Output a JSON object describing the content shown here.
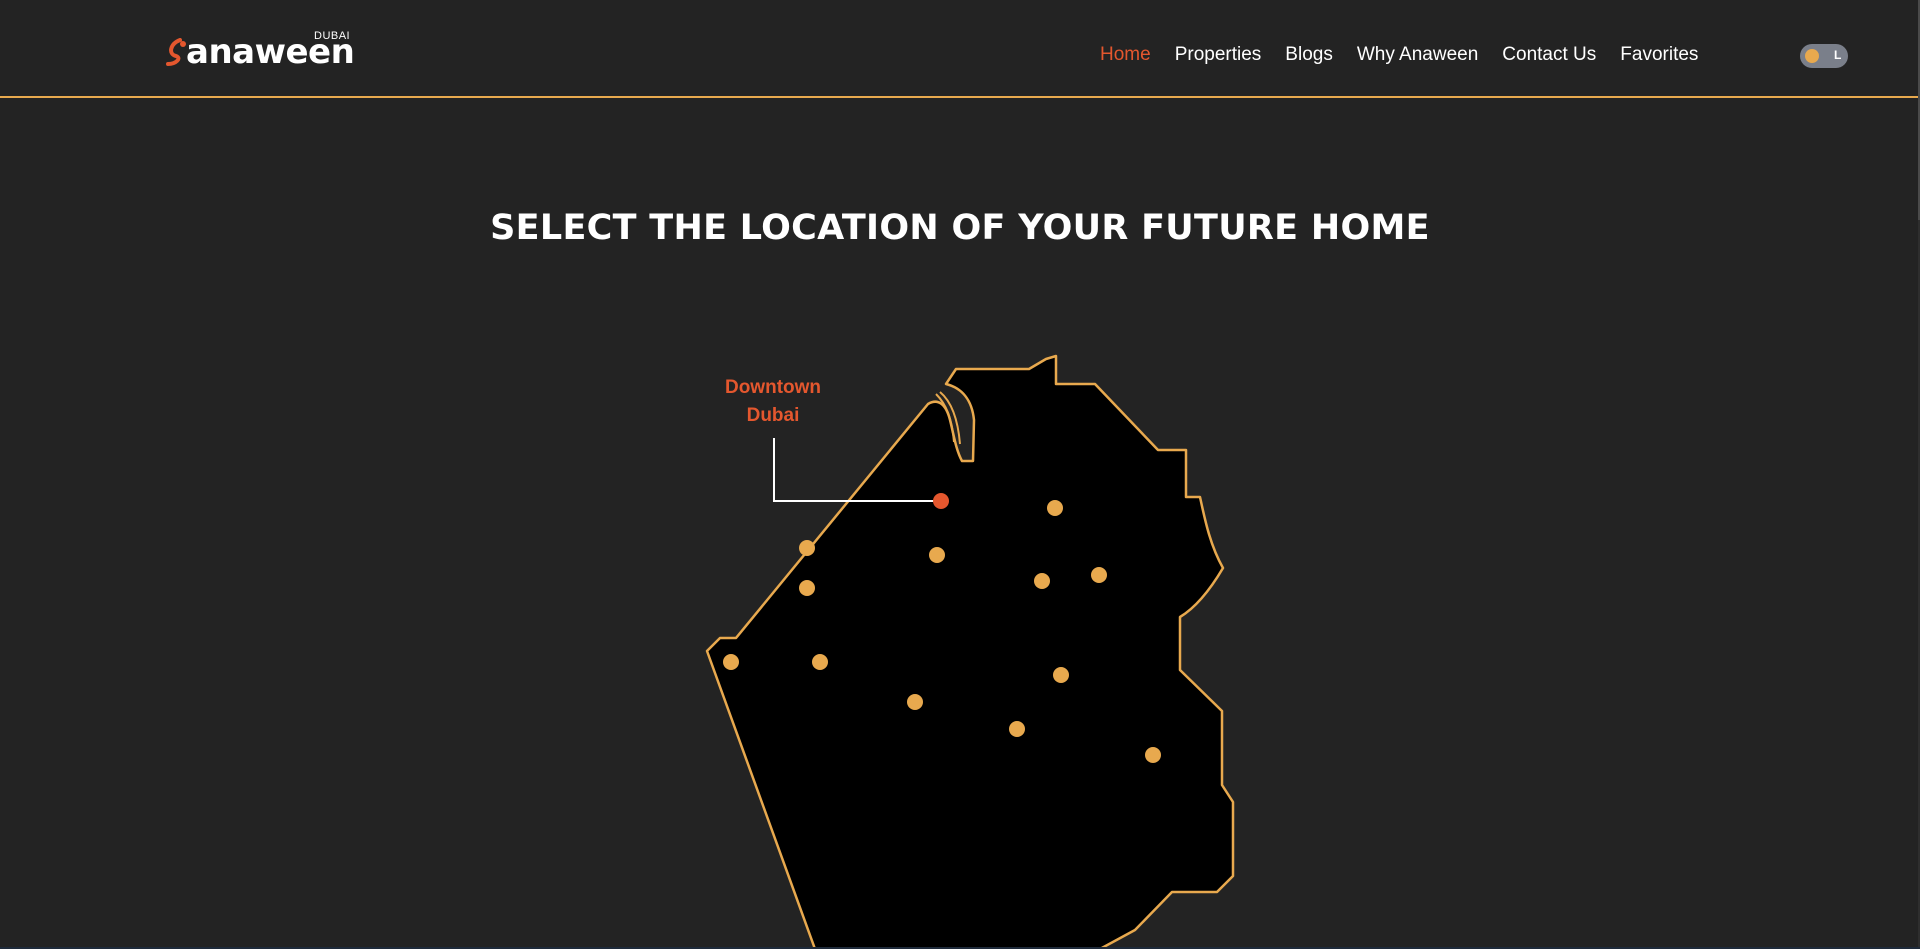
{
  "header": {
    "logo": {
      "name": "anaween",
      "sub": "DUBAI"
    },
    "nav": [
      {
        "label": "Home",
        "active": true
      },
      {
        "label": "Properties",
        "active": false
      },
      {
        "label": "Blogs",
        "active": false
      },
      {
        "label": "Why Anaween",
        "active": false
      },
      {
        "label": "Contact Us",
        "active": false
      },
      {
        "label": "Favorites",
        "active": false
      }
    ],
    "theme_toggle": {
      "label": "L"
    }
  },
  "main": {
    "heading": "SELECT THE LOCATION OF YOUR FUTURE HOME",
    "selected_location": "Downtown Dubai"
  },
  "colors": {
    "background": "#232323",
    "accent": "#e8a94e",
    "active": "#e4572e",
    "map_fill": "#000000",
    "text": "#ffffff"
  },
  "icons": {
    "logo_mark": "anaween-logo-icon",
    "toggle_knob": "theme-toggle-knob-icon"
  }
}
